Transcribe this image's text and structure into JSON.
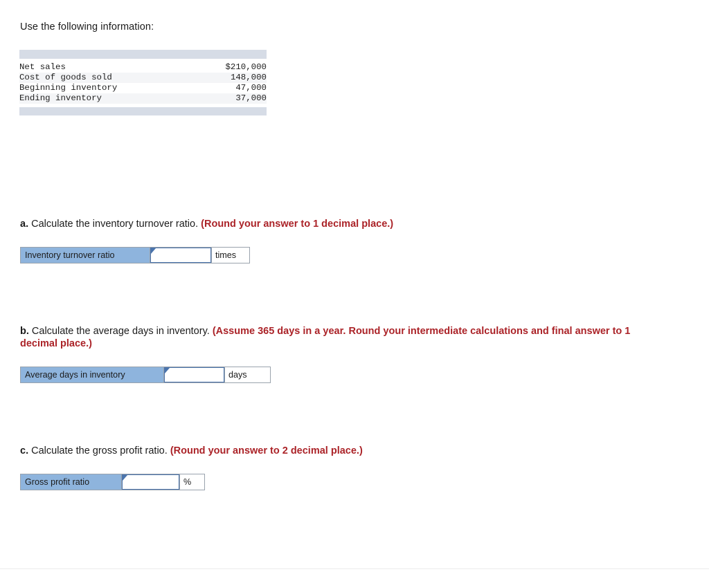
{
  "intro": {
    "text": "Use the following information:"
  },
  "info_table": {
    "rows": [
      {
        "label": "Net sales",
        "value": "$210,000"
      },
      {
        "label": "Cost of goods sold",
        "value": "148,000"
      },
      {
        "label": "Beginning inventory",
        "value": "47,000"
      },
      {
        "label": "Ending inventory",
        "value": "37,000"
      }
    ]
  },
  "questions": {
    "a": {
      "letter": "a.",
      "prompt": "Calculate the inventory turnover ratio.",
      "note": "(Round your answer to 1 decimal place.)",
      "answer": {
        "label": "Inventory turnover ratio",
        "value": "",
        "placeholder": "",
        "unit": "times"
      }
    },
    "b": {
      "letter": "b.",
      "prompt": "Calculate the average days in inventory.",
      "note": "(Assume 365 days in a year. Round your intermediate calculations and final answer to 1 decimal place.)",
      "answer": {
        "label": "Average days in inventory",
        "value": "",
        "placeholder": "",
        "unit": "days"
      }
    },
    "c": {
      "letter": "c.",
      "prompt": "Calculate the gross profit ratio.",
      "note": "(Round your answer to 2 decimal place.)",
      "answer": {
        "label": "Gross profit ratio",
        "value": "",
        "placeholder": "",
        "unit": "%"
      }
    }
  },
  "colors": {
    "note_red": "#ab2328",
    "label_blue": "#8eb4dd",
    "table_band": "#d6dce6",
    "table_stripe": "#f4f5f7",
    "input_border_blue": "#4b74ac"
  }
}
